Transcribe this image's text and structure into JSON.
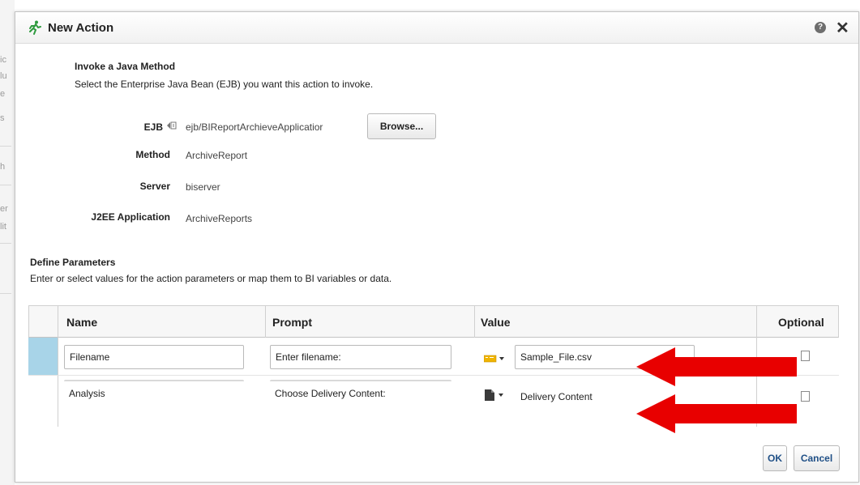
{
  "dialog": {
    "title": "New Action",
    "help_glyph": "?",
    "close_glyph": "✕"
  },
  "invoke": {
    "heading": "Invoke a Java Method",
    "description": "Select the Enterprise Java Bean (EJB) you want this action to invoke.",
    "ejb_label": "EJB",
    "ejb_value": "ejb/BIReportArchieveApplicatior",
    "browse_label": "Browse...",
    "method_label": "Method",
    "method_value": "ArchiveReport",
    "server_label": "Server",
    "server_value": "biserver",
    "j2ee_label": "J2EE Application",
    "j2ee_value": "ArchiveReports"
  },
  "params": {
    "heading": "Define Parameters",
    "description": "Enter or select values for the action parameters or map them to BI variables or data.",
    "columns": [
      "Name",
      "Prompt",
      "Value",
      "Optional"
    ],
    "rows": [
      {
        "name": "Filename",
        "prompt": "Enter filename:",
        "value": "Sample_File.csv",
        "value_type": "text-value-icon",
        "optional": false
      },
      {
        "name": "Analysis",
        "prompt": "Choose Delivery Content:",
        "value": "Delivery Content",
        "value_type": "document-icon",
        "optional": false
      }
    ]
  },
  "buttons": {
    "ok": "OK",
    "cancel": "Cancel"
  },
  "background_fragments": [
    "ic",
    "lu",
    "e",
    "s",
    "h",
    "er",
    "lit"
  ],
  "colors": {
    "selected_row": "#a8d4e8",
    "annotation_arrow": "#e80000",
    "button_text": "#1f4f86",
    "run_icon": "#2e9a3e"
  }
}
